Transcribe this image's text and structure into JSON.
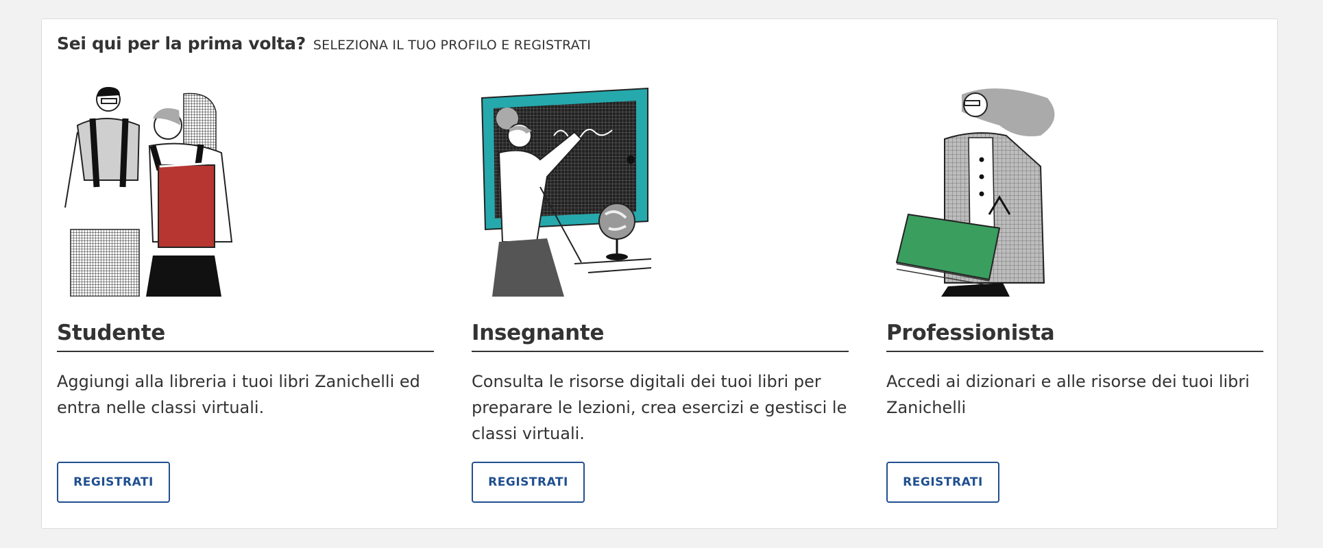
{
  "intro": {
    "title": "Sei qui per la prima volta?",
    "subtitle": "SELEZIONA IL TUO PROFILO E REGISTRATI"
  },
  "profiles": [
    {
      "title": "Studente",
      "description": "Aggiungi alla libreria i tuoi libri Zanichelli ed entra nelle classi virtuali.",
      "button_label": "REGISTRATI",
      "illustration": "students-with-backpack-and-red-book",
      "accent_color": "#b83632"
    },
    {
      "title": "Insegnante",
      "description": "Consulta le risorse digitali dei tuoi libri per preparare le lezioni, crea esercizi e gestisci le classi virtuali.",
      "button_label": "REGISTRATI",
      "illustration": "teacher-at-blackboard-with-globe",
      "accent_color": "#25a9ad"
    },
    {
      "title": "Professionista",
      "description": "Accedi ai dizionari e alle risorse dei tuoi libri Zanichelli",
      "button_label": "REGISTRATI",
      "illustration": "professional-with-green-book",
      "accent_color": "#3a9e5f"
    }
  ],
  "colors": {
    "button": "#1f4f8f",
    "text": "#333333",
    "background": "#f3f2f2"
  }
}
